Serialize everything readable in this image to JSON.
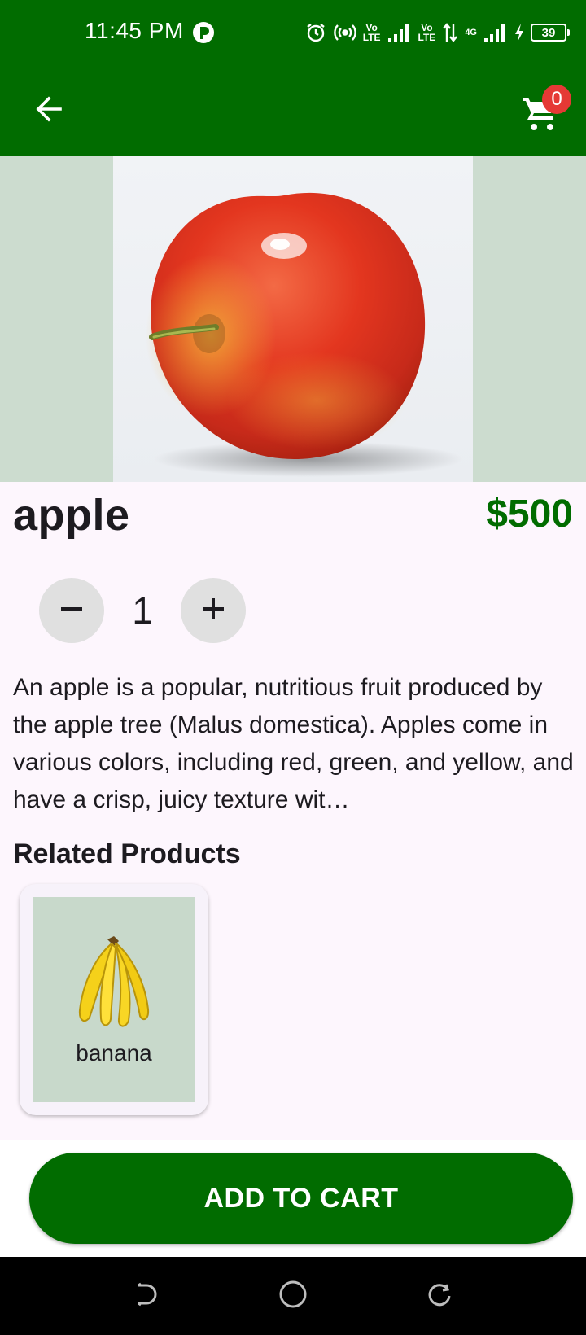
{
  "status_bar": {
    "time": "11:45 PM",
    "lte1": [
      "Vo",
      "LTE"
    ],
    "lte2": [
      "Vo",
      "LTE"
    ],
    "network": "4G",
    "battery": "39"
  },
  "app_bar": {
    "cart_count": "0"
  },
  "product": {
    "name": "apple",
    "price": "$500",
    "quantity": "1",
    "description": "An apple is a popular, nutritious fruit produced by the apple tree (Malus domestica). Apples come in various colors, including red, green, and yellow, and have a crisp, juicy texture wit…"
  },
  "related": {
    "title": "Related Products",
    "items": [
      {
        "name": "banana"
      }
    ]
  },
  "actions": {
    "add_to_cart": "ADD TO CART"
  },
  "colors": {
    "primary": "#016c00",
    "badge": "#e53935",
    "background": "#fdf6fd"
  }
}
